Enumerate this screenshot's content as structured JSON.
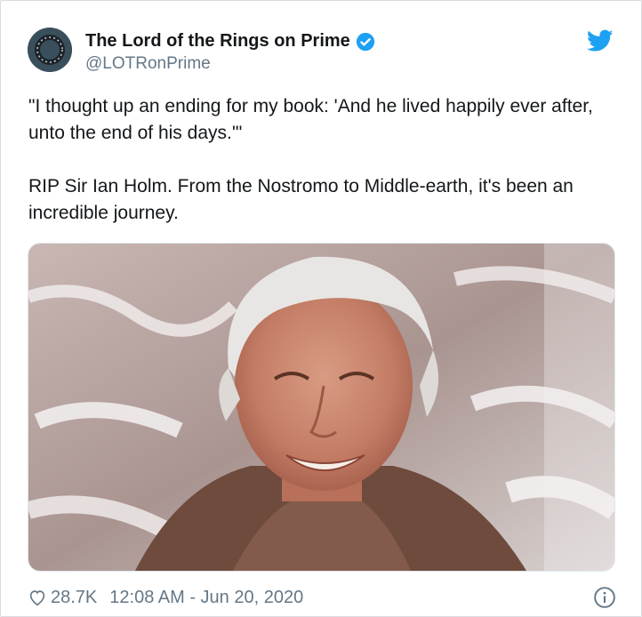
{
  "tweet": {
    "author_name": "The Lord of the Rings on Prime",
    "handle": "@LOTRonPrime",
    "paragraph1": "\"I thought up an ending for my book: 'And he lived happily ever after, unto the end of his days.'\"",
    "paragraph2": "RIP Sir Ian Holm. From the Nostromo to Middle-earth, it's been an incredible journey.",
    "likes": "28.7K",
    "timestamp": "12:08 AM - Jun 20, 2020"
  },
  "icons": {
    "verified": "verified-badge-icon",
    "bird": "twitter-bird-icon",
    "heart": "heart-icon",
    "info": "info-icon"
  },
  "colors": {
    "brand_blue": "#1da1f2",
    "text": "#14171a",
    "secondary_text": "#657786"
  }
}
